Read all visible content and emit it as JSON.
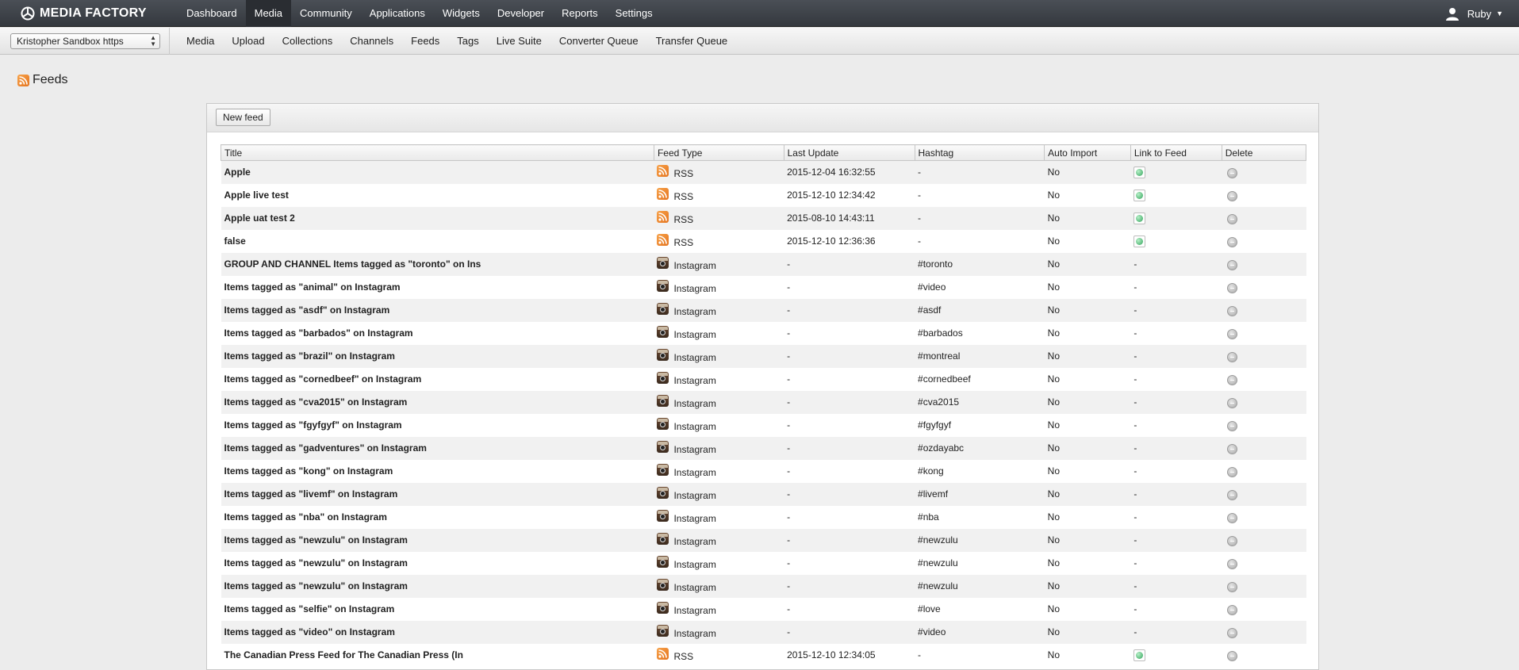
{
  "brand": {
    "name": "MEDIA FACTORY",
    "logo_icon": "media-factory-logo-icon"
  },
  "main_nav": [
    {
      "label": "Dashboard",
      "active": false
    },
    {
      "label": "Media",
      "active": true
    },
    {
      "label": "Community",
      "active": false
    },
    {
      "label": "Applications",
      "active": false
    },
    {
      "label": "Widgets",
      "active": false
    },
    {
      "label": "Developer",
      "active": false
    },
    {
      "label": "Reports",
      "active": false
    },
    {
      "label": "Settings",
      "active": false
    }
  ],
  "user": {
    "name": "Ruby",
    "icon": "user-icon"
  },
  "site_select": {
    "value": "Kristopher Sandbox https"
  },
  "sub_nav": [
    "Media",
    "Upload",
    "Collections",
    "Channels",
    "Feeds",
    "Tags",
    "Live Suite",
    "Converter Queue",
    "Transfer Queue"
  ],
  "page": {
    "title": "Feeds",
    "icon": "rss-icon",
    "new_feed_label": "New feed"
  },
  "table": {
    "columns": [
      "Title",
      "Feed Type",
      "Last Update",
      "Hashtag",
      "Auto Import",
      "Link to Feed",
      "Delete"
    ],
    "rows": [
      {
        "title": "Apple",
        "type": "RSS",
        "last_update": "2015-12-04 16:32:55",
        "hashtag": "-",
        "auto_import": "No",
        "link": true
      },
      {
        "title": "Apple live test",
        "type": "RSS",
        "last_update": "2015-12-10 12:34:42",
        "hashtag": "-",
        "auto_import": "No",
        "link": true
      },
      {
        "title": "Apple uat test 2",
        "type": "RSS",
        "last_update": "2015-08-10 14:43:11",
        "hashtag": "-",
        "auto_import": "No",
        "link": true
      },
      {
        "title": "false",
        "type": "RSS",
        "last_update": "2015-12-10 12:36:36",
        "hashtag": "-",
        "auto_import": "No",
        "link": true
      },
      {
        "title": "GROUP AND CHANNEL Items tagged as \"toronto\" on Ins",
        "type": "Instagram",
        "last_update": "-",
        "hashtag": "#toronto",
        "auto_import": "No",
        "link": false,
        "link_text": "-"
      },
      {
        "title": "Items tagged as \"animal\" on Instagram",
        "type": "Instagram",
        "last_update": "-",
        "hashtag": "#video",
        "auto_import": "No",
        "link": false,
        "link_text": "-"
      },
      {
        "title": "Items tagged as \"asdf\" on Instagram",
        "type": "Instagram",
        "last_update": "-",
        "hashtag": "#asdf",
        "auto_import": "No",
        "link": false,
        "link_text": "-"
      },
      {
        "title": "Items tagged as \"barbados\" on Instagram",
        "type": "Instagram",
        "last_update": "-",
        "hashtag": "#barbados",
        "auto_import": "No",
        "link": false,
        "link_text": "-"
      },
      {
        "title": "Items tagged as \"brazil\" on Instagram",
        "type": "Instagram",
        "last_update": "-",
        "hashtag": "#montreal",
        "auto_import": "No",
        "link": false,
        "link_text": "-"
      },
      {
        "title": "Items tagged as \"cornedbeef\" on Instagram",
        "type": "Instagram",
        "last_update": "-",
        "hashtag": "#cornedbeef",
        "auto_import": "No",
        "link": false,
        "link_text": "-"
      },
      {
        "title": "Items tagged as \"cva2015\" on Instagram",
        "type": "Instagram",
        "last_update": "-",
        "hashtag": "#cva2015",
        "auto_import": "No",
        "link": false,
        "link_text": "-"
      },
      {
        "title": "Items tagged as \"fgyfgyf\" on Instagram",
        "type": "Instagram",
        "last_update": "-",
        "hashtag": "#fgyfgyf",
        "auto_import": "No",
        "link": false,
        "link_text": "-"
      },
      {
        "title": "Items tagged as \"gadventures\" on Instagram",
        "type": "Instagram",
        "last_update": "-",
        "hashtag": "#ozdayabc",
        "auto_import": "No",
        "link": false,
        "link_text": "-"
      },
      {
        "title": "Items tagged as \"kong\" on Instagram",
        "type": "Instagram",
        "last_update": "-",
        "hashtag": "#kong",
        "auto_import": "No",
        "link": false,
        "link_text": "-"
      },
      {
        "title": "Items tagged as \"livemf\" on Instagram",
        "type": "Instagram",
        "last_update": "-",
        "hashtag": "#livemf",
        "auto_import": "No",
        "link": false,
        "link_text": "-"
      },
      {
        "title": "Items tagged as \"nba\" on Instagram",
        "type": "Instagram",
        "last_update": "-",
        "hashtag": "#nba",
        "auto_import": "No",
        "link": false,
        "link_text": "-"
      },
      {
        "title": "Items tagged as \"newzulu\" on Instagram",
        "type": "Instagram",
        "last_update": "-",
        "hashtag": "#newzulu",
        "auto_import": "No",
        "link": false,
        "link_text": "-"
      },
      {
        "title": "Items tagged as \"newzulu\" on Instagram",
        "type": "Instagram",
        "last_update": "-",
        "hashtag": "#newzulu",
        "auto_import": "No",
        "link": false,
        "link_text": "-"
      },
      {
        "title": "Items tagged as \"newzulu\" on Instagram",
        "type": "Instagram",
        "last_update": "-",
        "hashtag": "#newzulu",
        "auto_import": "No",
        "link": false,
        "link_text": "-"
      },
      {
        "title": "Items tagged as \"selfie\" on Instagram",
        "type": "Instagram",
        "last_update": "-",
        "hashtag": "#love",
        "auto_import": "No",
        "link": false,
        "link_text": "-"
      },
      {
        "title": "Items tagged as \"video\" on Instagram",
        "type": "Instagram",
        "last_update": "-",
        "hashtag": "#video",
        "auto_import": "No",
        "link": false,
        "link_text": "-"
      },
      {
        "title": "The Canadian Press Feed for The Canadian Press (In",
        "type": "RSS",
        "last_update": "2015-12-10 12:34:05",
        "hashtag": "-",
        "auto_import": "No",
        "link": true
      }
    ]
  },
  "colors": {
    "topbar": "#3d4147",
    "rss": "#e8822c",
    "link_green": "#31a35a"
  }
}
